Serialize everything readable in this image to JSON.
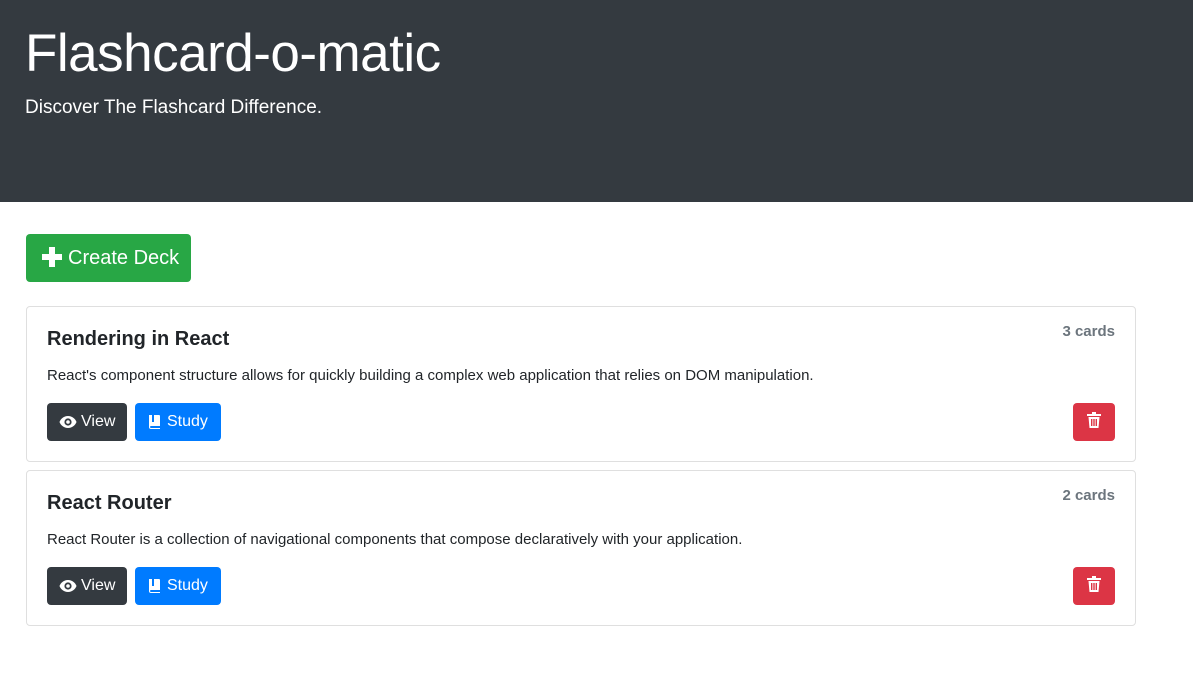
{
  "header": {
    "title": "Flashcard-o-matic",
    "subtitle": "Discover The Flashcard Difference."
  },
  "create_button": {
    "label": "Create Deck",
    "icon": "plus-icon"
  },
  "decks": [
    {
      "name": "Rendering in React",
      "count": "3 cards",
      "description": "React's component structure allows for quickly building a complex web application that relies on DOM manipulation.",
      "view_label": "View",
      "study_label": "Study"
    },
    {
      "name": "React Router",
      "count": "2 cards",
      "description": "React Router is a collection of navigational components that compose declaratively with your application.",
      "view_label": "View",
      "study_label": "Study"
    }
  ],
  "colors": {
    "header_bg": "#343a40",
    "create": "#28a745",
    "view": "#343a40",
    "study": "#007bff",
    "delete": "#dc3545"
  }
}
